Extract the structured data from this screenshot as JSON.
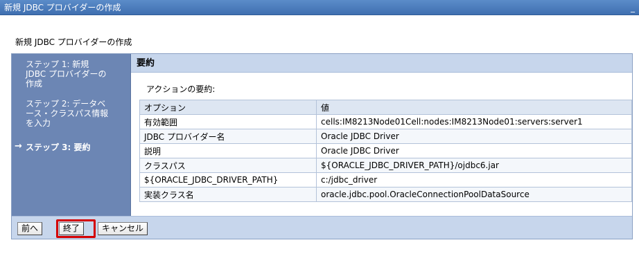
{
  "window": {
    "title": "新規 JDBC プロバイダーの作成",
    "minimize_glyph": "_"
  },
  "page": {
    "heading": "新規 JDBC プロバイダーの作成"
  },
  "wizard": {
    "steps": [
      {
        "label": "ステップ 1: 新規\nJDBC プロバイダーの\n作成",
        "current": false
      },
      {
        "label": "ステップ 2: データベ\nース・クラスパス情報\nを入力",
        "current": false
      },
      {
        "label": "ステップ 3: 要約",
        "current": true
      }
    ],
    "current_arrow": "→",
    "content_header": "要約",
    "summary_label": "アクションの要約:",
    "table": {
      "columns": [
        "オプション",
        "値"
      ],
      "rows": [
        [
          "有効範囲",
          "cells:IM8213Node01Cell:nodes:IM8213Node01:servers:server1"
        ],
        [
          "JDBC プロバイダー名",
          "Oracle JDBC Driver"
        ],
        [
          "説明",
          "Oracle JDBC Driver"
        ],
        [
          "クラスパス",
          "${ORACLE_JDBC_DRIVER_PATH}/ojdbc6.jar"
        ],
        [
          "${ORACLE_JDBC_DRIVER_PATH}",
          "c:/jdbc_driver"
        ],
        [
          "実装クラス名",
          "oracle.jdbc.pool.OracleConnectionPoolDataSource"
        ]
      ]
    },
    "buttons": {
      "prev": "前へ",
      "finish": "終了",
      "cancel": "キャンセル"
    },
    "highlight_color": "#d40000"
  },
  "colors": {
    "titlebar": "#4a7cbf",
    "sidebar": "#6c86b4",
    "header_band": "#c7d6ec"
  }
}
